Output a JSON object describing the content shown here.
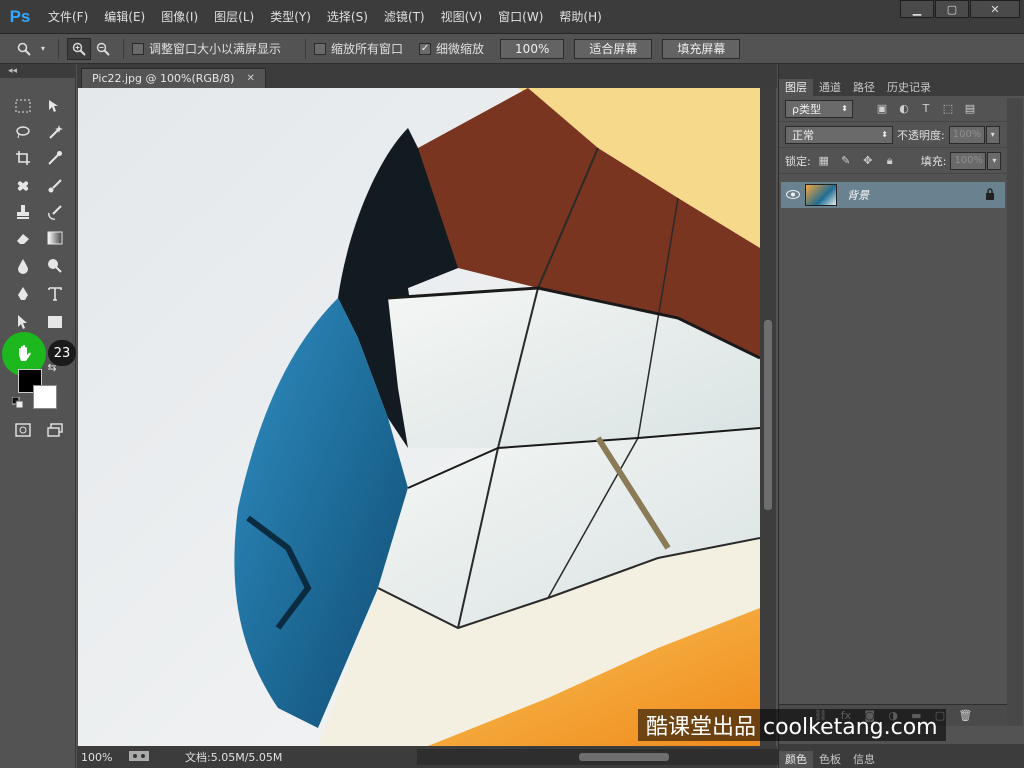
{
  "menubar": {
    "logo": "Ps",
    "items": [
      "文件(F)",
      "编辑(E)",
      "图像(I)",
      "图层(L)",
      "类型(Y)",
      "选择(S)",
      "滤镜(T)",
      "视图(V)",
      "窗口(W)",
      "帮助(H)"
    ],
    "window_controls": [
      "▁",
      "▢",
      "✕"
    ]
  },
  "options": {
    "resize_windows": "调整窗口大小以满屏显示",
    "zoom_all_windows": "缩放所有窗口",
    "scrubby_zoom": "细微缩放",
    "zoom_100": "100%",
    "fit_screen": "适合屏幕",
    "fill_screen": "填充屏幕",
    "scrubby_checked": true
  },
  "toolbox": {
    "collapse": "◂◂",
    "step_number": "23"
  },
  "document": {
    "tab_title": "Pic22.jpg @ 100%(RGB/8)",
    "tab_close": "✕",
    "status_zoom": "100%",
    "status_doc": "文档:5.05M/5.05M"
  },
  "layers_panel": {
    "tabs": [
      "图层",
      "通道",
      "路径",
      "历史记录"
    ],
    "filter_label": "ρ类型",
    "blend_mode": "正常",
    "opacity_label": "不透明度:",
    "opacity_value": "100%",
    "lock_label": "锁定:",
    "fill_label": "填充:",
    "fill_value": "100%",
    "layer_name": "背景"
  },
  "bottom_panel": {
    "tabs": [
      "颜色",
      "色板",
      "信息"
    ]
  },
  "watermark": "酷课堂出品 coolketang.com"
}
